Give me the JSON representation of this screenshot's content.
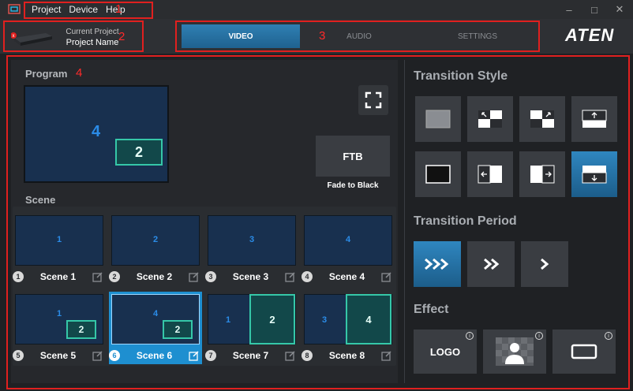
{
  "menu": {
    "items": [
      "Project",
      "Device",
      "Help"
    ]
  },
  "annotations": {
    "box1": "1",
    "box2": "2",
    "box3": "3",
    "box4": "4"
  },
  "project": {
    "label": "Current Project",
    "name": "Project Name"
  },
  "tabs": [
    {
      "label": "VIDEO",
      "active": true
    },
    {
      "label": "AUDIO",
      "active": false
    },
    {
      "label": "SETTINGS",
      "active": false
    }
  ],
  "brand": "ATEN",
  "program": {
    "title": "Program",
    "main_source": "4",
    "pip_source": "2",
    "ftb_label": "FTB",
    "ftb_caption": "Fade to Black"
  },
  "scene_section": {
    "title": "Scene"
  },
  "scenes": [
    {
      "index": "1",
      "name": "Scene 1",
      "main": "1",
      "pip": "",
      "active": false
    },
    {
      "index": "2",
      "name": "Scene 2",
      "main": "2",
      "pip": "",
      "active": false
    },
    {
      "index": "3",
      "name": "Scene 3",
      "main": "3",
      "pip": "",
      "active": false
    },
    {
      "index": "4",
      "name": "Scene 4",
      "main": "4",
      "pip": "",
      "active": false
    },
    {
      "index": "5",
      "name": "Scene 5",
      "main": "1",
      "pip": "2",
      "active": false
    },
    {
      "index": "6",
      "name": "Scene 6",
      "main": "4",
      "pip": "2",
      "active": true
    },
    {
      "index": "7",
      "name": "Scene 7",
      "main": "1",
      "pip": "2",
      "active": false
    },
    {
      "index": "8",
      "name": "Scene 8",
      "main": "3",
      "pip": "4",
      "active": false
    }
  ],
  "transition_style": {
    "title": "Transition Style",
    "options": [
      "fade-icon",
      "wipe-top-left-icon",
      "wipe-top-right-icon",
      "slide-up-icon",
      "cut-icon",
      "slide-left-icon",
      "slide-right-icon",
      "slide-down-icon"
    ],
    "selected_index": 7
  },
  "transition_period": {
    "title": "Transition Period",
    "options": [
      "fast-icon",
      "medium-icon",
      "slow-icon"
    ],
    "selected_index": 0
  },
  "effect": {
    "title": "Effect",
    "logo_label": "LOGO",
    "options": [
      "logo-effect",
      "chroma-key-effect",
      "border-effect"
    ]
  },
  "colors": {
    "accent": "#1e8fd0",
    "annotation": "#e0201f",
    "pip_border": "#35c7a8"
  }
}
